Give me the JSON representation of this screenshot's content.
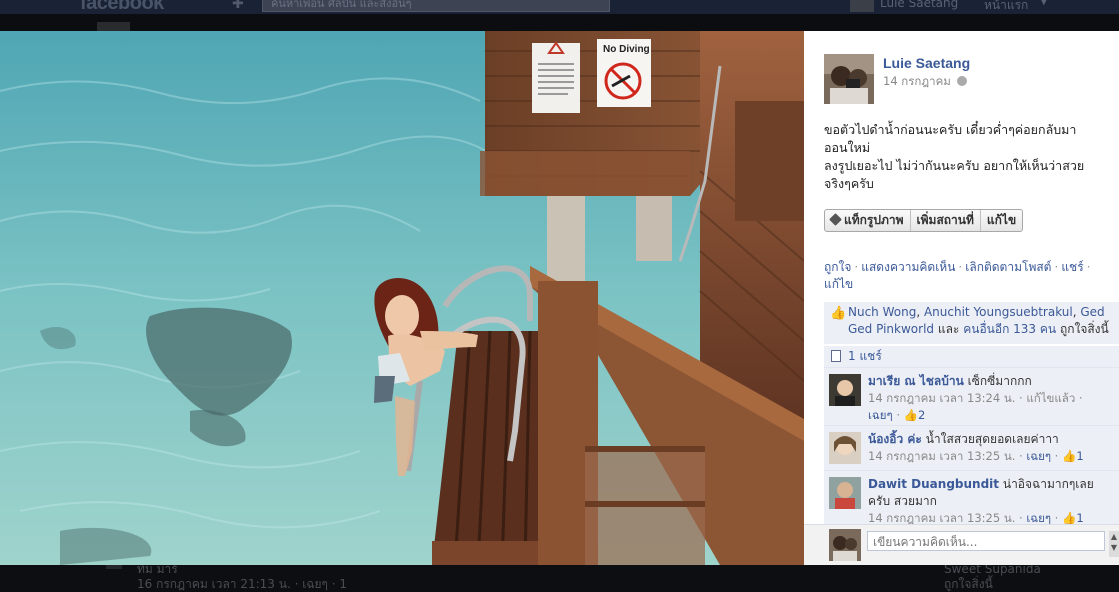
{
  "topbar": {
    "logo": "facebook",
    "search_placeholder": "ค้นหาเพื่อน ศิลปิน และสิ่งอื่นๆ",
    "user_name": "Luie Saetang",
    "home_label": "หน้าแรก"
  },
  "photo": {
    "sign_no_diving": "No Diving"
  },
  "post": {
    "author": "Luie Saetang",
    "date": "14 กรกฎาคม",
    "caption_lines": [
      "ขอตัวไปดำน้ำก่อนนะครับ เดี๋ยวค่ำๆค่อยกลับมา",
      "ออนใหม่",
      "ลงรูปเยอะไป ไม่ว่ากันนะครับ อยากให้เห็นว่าสวย",
      "จริงๆครับ"
    ],
    "buttons": {
      "tag": "แท็กรูปภาพ",
      "add_location": "เพิ่มสถานที่",
      "edit": "แก้ไข"
    },
    "actions": {
      "like": "ถูกใจ",
      "comment": "แสดงความคิดเห็น",
      "unfollow": "เลิกติดตามโพสต์",
      "share": "แชร์",
      "edit": "แก้ไข"
    },
    "likes": {
      "name1": "Nuch Wong",
      "name2": "Anuchit Youngsuebtrakul",
      "name3a": "Ged",
      "name3b": "Ged Pinkworld",
      "and": "และ",
      "others": "คนอื่นอีก 133 คน",
      "suffix": "ถูกใจสิ่งนี้"
    },
    "shares": "1 แชร์"
  },
  "comments": [
    {
      "name": "มาเรีย ณ ไชลบ้าน",
      "text": "เซ็กซี่มากกก",
      "meta": "14 กรกฎาคม เวลา 13:24 น.",
      "edited": "แก้ไขแล้ว",
      "like": "เฉยๆ",
      "likes": "2"
    },
    {
      "name": "น้องอิ้ว ค่ะ",
      "text": "น้ำใสสวยสุดยอดเลยค่าาา",
      "meta": "14 กรกฎาคม เวลา 13:25 น.",
      "like": "เฉยๆ",
      "likes": "1"
    },
    {
      "name": "Dawit Duangbundit",
      "text": "น่าอิจฉามากๆเลย",
      "text2": "ครับ สวยมาก",
      "meta": "14 กรกฎาคม เวลา 13:25 น.",
      "like": "เฉยๆ",
      "likes": "1"
    }
  ],
  "composer": {
    "placeholder": "เขียนความคิดเห็น..."
  },
  "bottom": {
    "left_line1": "ทิม มาร์",
    "left_line2": "16 กรกฎาคม เวลา 21:13 น. · เฉยๆ · 1",
    "right_line1": "Sweet Supanida",
    "right_line2": "ถูกใจสิ่งนี้"
  }
}
